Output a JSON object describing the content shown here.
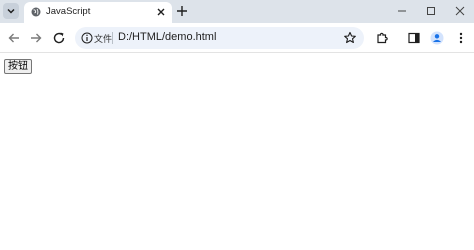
{
  "tabs": [
    {
      "title": "JavaScript"
    }
  ],
  "address_bar": {
    "site_info_label": "文件",
    "url": "D:/HTML/demo.html"
  },
  "page": {
    "button_label": "按钮"
  },
  "icons": {
    "tab_search": "chevron-down-icon",
    "favicon": "globe-icon",
    "tab_close": "close-icon",
    "new_tab": "plus-icon",
    "back": "arrow-left-icon",
    "forward": "arrow-right-icon",
    "reload": "reload-icon",
    "site_info": "info-icon",
    "bookmark": "star-icon",
    "extensions": "puzzle-icon",
    "side_panel": "side-panel-icon",
    "profile": "profile-icon",
    "menu": "more-vert-icon"
  },
  "colors": {
    "tabstrip": "#dde3ea",
    "omnibox": "#edf2fa",
    "profile_accent": "#1a73e8"
  }
}
